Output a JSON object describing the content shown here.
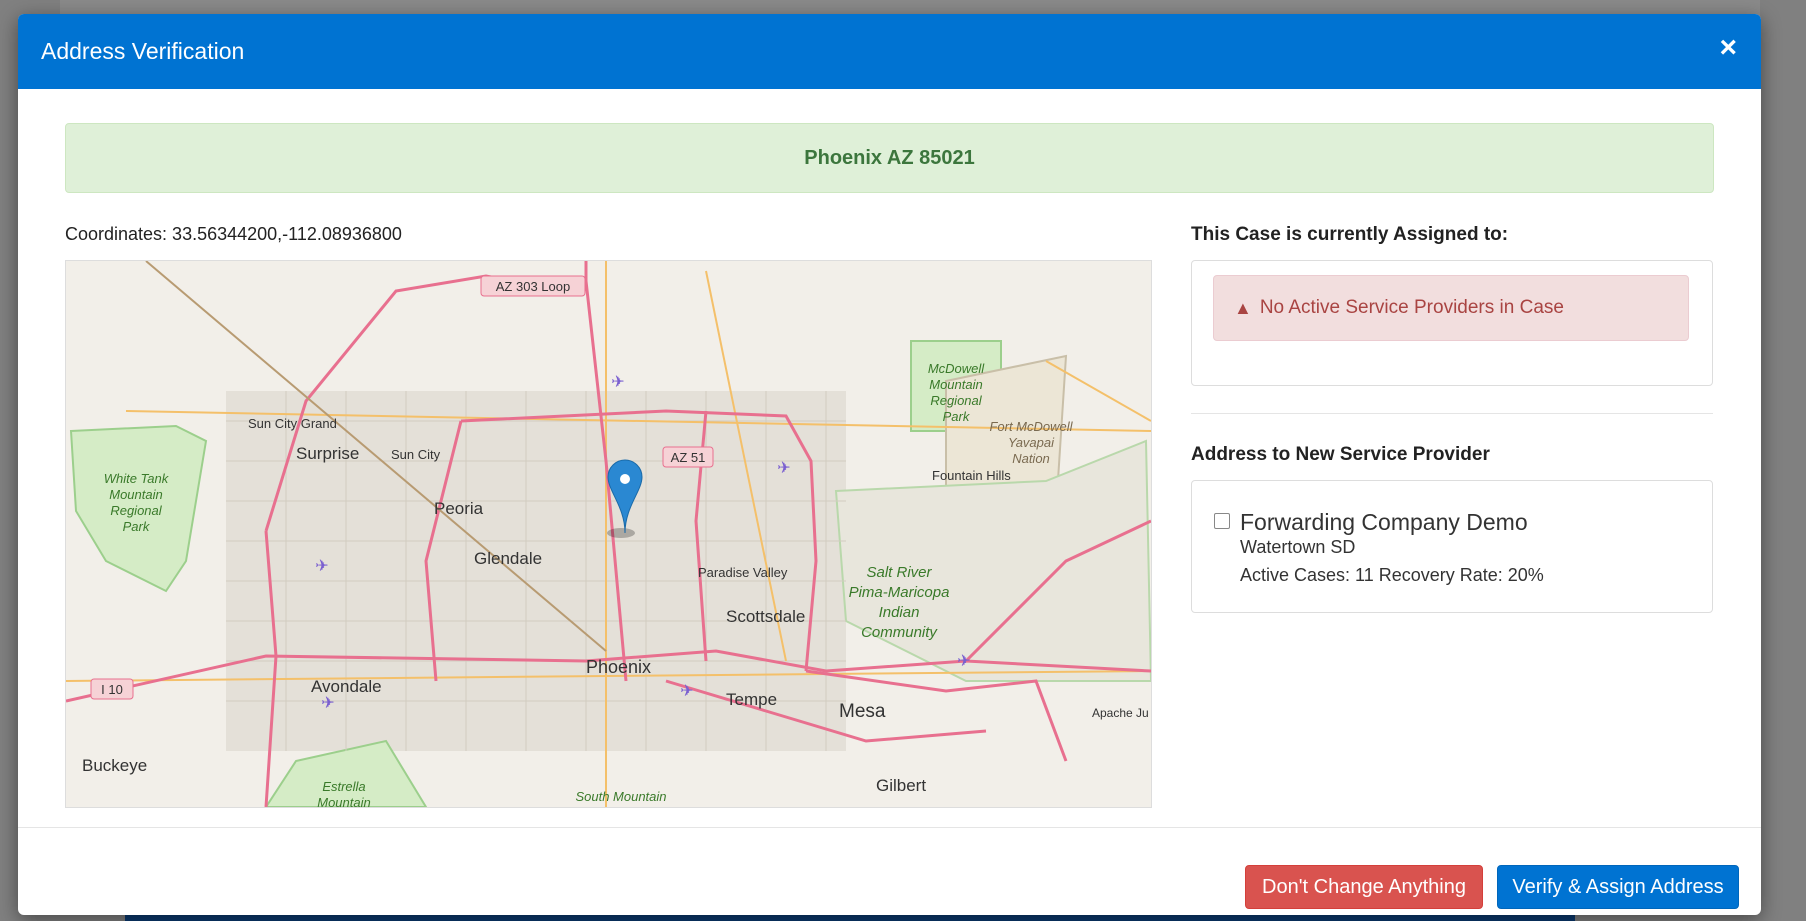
{
  "modal": {
    "title": "Address Verification",
    "close_glyph": "×"
  },
  "address_banner": "Phoenix AZ 85021",
  "coordinates_text": "Coordinates: 33.56344200,-112.08936800",
  "map": {
    "labels": {
      "az303": "AZ 303 Loop",
      "az51": "AZ 51",
      "i10": "I 10",
      "sun_city_grand": "Sun City Grand",
      "surprise": "Surprise",
      "sun_city": "Sun City",
      "peoria": "Peoria",
      "glendale": "Glendale",
      "phoenix": "Phoenix",
      "avondale": "Avondale",
      "buckeye": "Buckeye",
      "tempe": "Tempe",
      "mesa": "Mesa",
      "gilbert": "Gilbert",
      "scottsdale": "Scottsdale",
      "paradise_valley": "Paradise Valley",
      "fountain_hills": "Fountain Hills",
      "apache_junction": "Apache Ju",
      "white_tank": [
        "White Tank",
        "Mountain",
        "Regional",
        "Park"
      ],
      "mcdowell": [
        "McDowell",
        "Mountain",
        "Regional",
        "Park"
      ],
      "fort_mcdowell": [
        "Fort McDowell",
        "Yavapai",
        "Nation"
      ],
      "salt_river": [
        "Salt River",
        "Pima-Maricopa",
        "Indian",
        "Community"
      ],
      "estrella": [
        "Estrella",
        "Mountain"
      ],
      "south_mountain": "South Mountain"
    }
  },
  "assigned": {
    "heading": "This Case is currently Assigned to:",
    "alert_icon": "warning-triangle",
    "alert_text": "No Active Service Providers in Case"
  },
  "new_provider": {
    "heading": "Address to New Service Provider",
    "provider": {
      "name": "Forwarding Company Demo",
      "location": "Watertown SD",
      "stats": "Active Cases: 11 Recovery Rate: 20%",
      "checked": false
    }
  },
  "footer": {
    "cancel_label": "Don't Change Anything",
    "confirm_label": "Verify & Assign Address"
  },
  "colors": {
    "header": "#0073d2",
    "success_bg": "#dff0d8",
    "success_text": "#3c763d",
    "danger_bg": "#f2dede",
    "danger_text": "#a94442",
    "btn_danger": "#d9534f",
    "btn_primary": "#0073d2"
  }
}
